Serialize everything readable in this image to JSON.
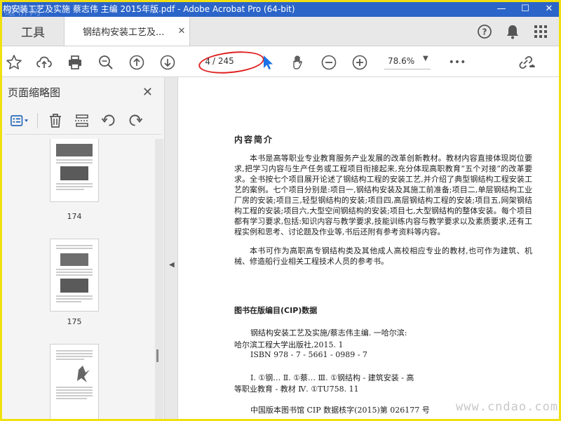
{
  "window": {
    "title": "构安装工艺及实施 蔡志伟 主编 2015年版.pdf - Adobe Acrobat Pro (64-bit)",
    "minimize": "—",
    "maximize": "☐",
    "close": "✕"
  },
  "watermark_top": "道桥网",
  "tabs": {
    "tools_label": "工具",
    "doc_tab_label": "钢结构安装工艺及...",
    "doc_tab_close": "✕"
  },
  "toolbar": {
    "current_page": "4",
    "total_pages": "/ 245",
    "zoom": "78.6%",
    "zoom_caret": "▼",
    "more": "•••"
  },
  "left_pane": {
    "title": "页面缩略图",
    "close": "✕",
    "thumbnails": [
      {
        "label": "174"
      },
      {
        "label": "175"
      },
      {
        "label": ""
      }
    ]
  },
  "document": {
    "intro_title": "内容简介",
    "intro_paragraphs": [
      "本书是高等职业专业教育服务产业发展的改革创新教材。教材内容直接体现岗位要求,把学习内容与生产任务或工程项目衔接起来,充分体现高职教育“五个对接”的改革要求。全书按七个项目展开论述了钢结构工程的安装工艺,并介绍了典型钢结构工程安装工艺的案例。七个项目分别是:项目一,钢结构安装及其施工前准备;项目二,单层钢结构工业厂房的安装;项目三,轻型钢结构的安装;项目四,高层钢结构工程的安装;项目五,网架钢结构工程的安装;项目六,大型空间钢结构的安装;项目七,大型钢结构的整体安装。每个项目都有学习要求,包括:知识内容与教学要求,技能训练内容与教学要求以及素质要求,还有工程实例和思考、讨论题及作业等,书后还附有参考资料等内容。",
      "本书可作为高职高专钢结构类及其他成人高校相应专业的教材,也可作为建筑、机械、修造船行业相关工程技术人员的参考书。"
    ],
    "cip_title": "图书在版编目(CIP)数据",
    "cip_lines": [
      "钢结构安装工艺及实施/蔡志伟主编. 一哈尔滨:",
      "哈尔滨工程大学出版社,2015. 1",
      "ISBN 978 - 7 - 5661 - 0989 - 7",
      "Ⅰ. ①钢…   Ⅱ. ①蔡…   Ⅲ. ①钢结构 - 建筑安装 - 高",
      "等职业教育 - 教材   Ⅳ. ①TU758. 11",
      "中国版本图书馆 CIP 数据核字(2015)第 026177 号"
    ]
  },
  "site_watermark": "www.cndao.com",
  "colors": {
    "titlebar": "#2b65c9",
    "frame": "#f0e010",
    "annotation": "#e02020",
    "cursor": "#1a73e8"
  }
}
